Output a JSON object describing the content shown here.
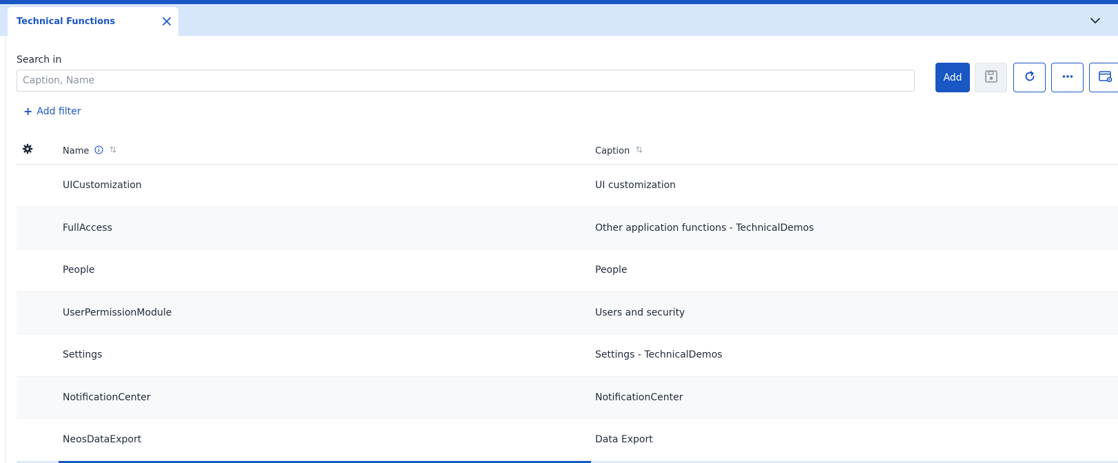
{
  "tab": {
    "title": "Technical Functions"
  },
  "search": {
    "label": "Search in",
    "placeholder": "Caption, Name",
    "value": ""
  },
  "filters": {
    "add_label": "Add filter"
  },
  "toolbar": {
    "add_label": "Add"
  },
  "icons": {
    "close": "close-icon",
    "chevron": "chevron-down-icon",
    "save": "floppy-disk-icon",
    "refresh": "refresh-icon",
    "more": "ellipsis-icon",
    "layout": "window-settings-icon",
    "columns": "gear-icon",
    "info": "info-icon",
    "sort": "sort-icon"
  },
  "colors": {
    "accent": "#1a56c4",
    "tabstrip": "#d6e6fb",
    "row_alt": "#f7f9fa"
  },
  "grid": {
    "columns": [
      {
        "label": "Name"
      },
      {
        "label": "Caption"
      }
    ],
    "rows": [
      {
        "name": "UICustomization",
        "caption": "UI customization"
      },
      {
        "name": "FullAccess",
        "caption": "Other application functions - TechnicalDemos"
      },
      {
        "name": "People",
        "caption": "People"
      },
      {
        "name": "UserPermissionModule",
        "caption": "Users and security"
      },
      {
        "name": "Settings",
        "caption": "Settings - TechnicalDemos"
      },
      {
        "name": "NotificationCenter",
        "caption": "NotificationCenter"
      },
      {
        "name": "NeosDataExport",
        "caption": "Data Export"
      }
    ]
  }
}
